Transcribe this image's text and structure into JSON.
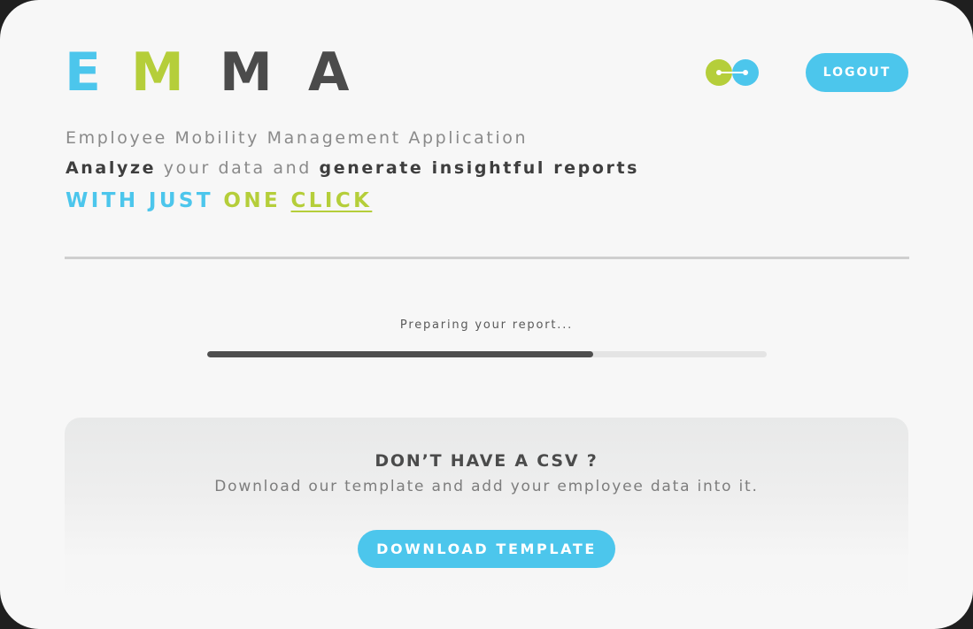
{
  "app": {
    "logo_letters": [
      "E",
      "M",
      "M",
      "A"
    ],
    "colors": {
      "blue": "#4cc6ec",
      "green": "#b5ce3a",
      "dark": "#4b4b4b",
      "background": "#f7f7f7"
    }
  },
  "header": {
    "icon": "link-icon",
    "logout_label": "LOGOUT"
  },
  "hero": {
    "subtitle": "Employee Mobility Management Application",
    "line2": {
      "w1": "Analyze",
      "w2": "your data and",
      "w3": "generate insightful reports"
    },
    "line3": {
      "w1": "WITH JUST",
      "w2": "ONE",
      "w3": "CLICK"
    }
  },
  "progress": {
    "label": "Preparing your report...",
    "percent": 69
  },
  "csv_card": {
    "title": "DON’T HAVE A CSV ?",
    "description": "Download our template and add your employee data into it.",
    "button_label": "DOWNLOAD TEMPLATE"
  }
}
